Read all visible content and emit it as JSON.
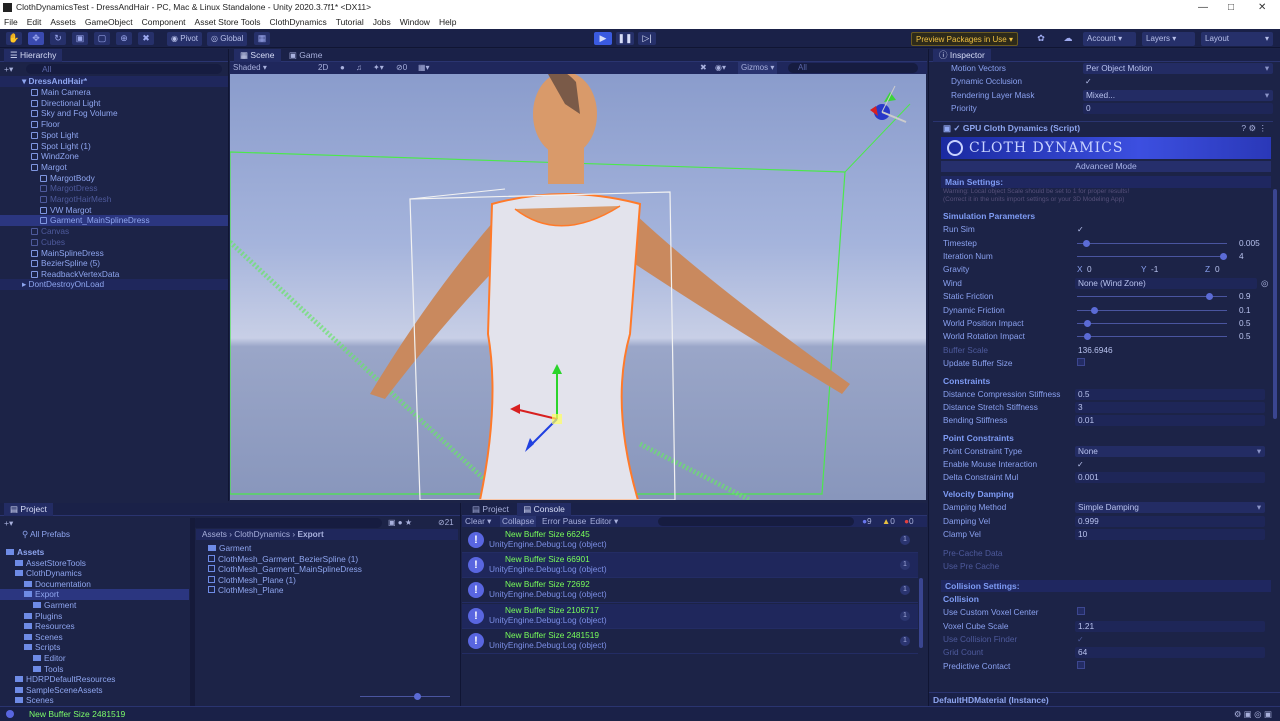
{
  "window": {
    "title": "ClothDynamicsTest - DressAndHair - PC, Mac & Linux Standalone - Unity 2020.3.7f1* <DX11>"
  },
  "menu": [
    "File",
    "Edit",
    "Assets",
    "GameObject",
    "Component",
    "Asset Store Tools",
    "ClothDynamics",
    "Tutorial",
    "Jobs",
    "Window",
    "Help"
  ],
  "toolbar": {
    "pivot": "Pivot",
    "global": "Global",
    "preview_packages": "Preview Packages in Use",
    "account": "Account",
    "layers": "Layers",
    "layout": "Layout"
  },
  "hierarchy": {
    "title": "Hierarchy",
    "search_placeholder": "All",
    "scene_root": "DressAndHair*",
    "items": [
      {
        "label": "Main Camera",
        "indent": 1,
        "dim": false
      },
      {
        "label": "Directional Light",
        "indent": 1,
        "dim": false
      },
      {
        "label": "Sky and Fog Volume",
        "indent": 1,
        "dim": false
      },
      {
        "label": "Floor",
        "indent": 1,
        "dim": false
      },
      {
        "label": "Spot Light",
        "indent": 1,
        "dim": false
      },
      {
        "label": "Spot Light (1)",
        "indent": 1,
        "dim": false
      },
      {
        "label": "WindZone",
        "indent": 1,
        "dim": false
      },
      {
        "label": "Margot",
        "indent": 1,
        "dim": false
      },
      {
        "label": "MargotBody",
        "indent": 2,
        "dim": false
      },
      {
        "label": "MargotDress",
        "indent": 2,
        "dim": true
      },
      {
        "label": "MargotHairMesh",
        "indent": 2,
        "dim": true
      },
      {
        "label": "VW Margot",
        "indent": 2,
        "dim": false
      },
      {
        "label": "Garment_MainSplineDress",
        "indent": 2,
        "dim": false,
        "selected": true
      },
      {
        "label": "Canvas",
        "indent": 1,
        "dim": true
      },
      {
        "label": "Cubes",
        "indent": 1,
        "dim": true
      },
      {
        "label": "MainSplineDress",
        "indent": 1,
        "dim": false
      },
      {
        "label": "BezierSpline (5)",
        "indent": 1,
        "dim": false
      },
      {
        "label": "ReadbackVertexData",
        "indent": 1,
        "dim": false
      }
    ],
    "dont_destroy": "DontDestroyOnLoad"
  },
  "scene_view": {
    "tab_scene": "Scene",
    "tab_game": "Game",
    "shading": "Shaded",
    "mode_2d": "2D",
    "gizmos": "Gizmos",
    "search_placeholder": "All"
  },
  "project": {
    "tab_project": "Project",
    "tab_console": "Console",
    "all_prefabs": "All Prefabs",
    "tree": [
      {
        "label": "Assets",
        "indent": 0,
        "bold": true
      },
      {
        "label": "AssetStoreTools",
        "indent": 1
      },
      {
        "label": "ClothDynamics",
        "indent": 1
      },
      {
        "label": "Documentation",
        "indent": 2
      },
      {
        "label": "Export",
        "indent": 2,
        "selected": true
      },
      {
        "label": "Garment",
        "indent": 3
      },
      {
        "label": "Plugins",
        "indent": 2
      },
      {
        "label": "Resources",
        "indent": 2
      },
      {
        "label": "Scenes",
        "indent": 2
      },
      {
        "label": "Scripts",
        "indent": 2
      },
      {
        "label": "Editor",
        "indent": 3
      },
      {
        "label": "Tools",
        "indent": 3
      },
      {
        "label": "HDRPDefaultResources",
        "indent": 1
      },
      {
        "label": "SampleSceneAssets",
        "indent": 1
      },
      {
        "label": "Scenes",
        "indent": 1
      }
    ],
    "breadcrumb": [
      "Assets",
      "ClothDynamics",
      "Export"
    ],
    "files": [
      "Garment",
      "ClothMesh_Garment_BezierSpline (1)",
      "ClothMesh_Garment_MainSplineDress",
      "ClothMesh_Plane (1)",
      "ClothMesh_Plane"
    ],
    "hidden_count": "21"
  },
  "console": {
    "clear": "Clear",
    "collapse": "Collapse",
    "error_pause": "Error Pause",
    "editor": "Editor",
    "counts": {
      "info": "9",
      "warn": "0",
      "error": "0"
    },
    "entries": [
      {
        "msg": "New Buffer Size 66245",
        "src": "UnityEngine.Debug:Log (object)",
        "count": "1"
      },
      {
        "msg": "New Buffer Size 66901",
        "src": "UnityEngine.Debug:Log (object)",
        "count": "1"
      },
      {
        "msg": "New Buffer Size 72692",
        "src": "UnityEngine.Debug:Log (object)",
        "count": "1"
      },
      {
        "msg": "New Buffer Size 2106717",
        "src": "UnityEngine.Debug:Log (object)",
        "count": "1"
      },
      {
        "msg": "New Buffer Size 2481519",
        "src": "UnityEngine.Debug:Log (object)",
        "count": "1"
      }
    ]
  },
  "inspector": {
    "title": "Inspector",
    "top_rows": [
      {
        "label": "Motion Vectors",
        "value": "Per Object Motion",
        "kind": "dropdown"
      },
      {
        "label": "Dynamic Occlusion",
        "value": "✓",
        "kind": "check"
      },
      {
        "label": "Rendering Layer Mask",
        "value": "Mixed...",
        "kind": "dropdown"
      },
      {
        "label": "Priority",
        "value": "0",
        "kind": "field"
      }
    ],
    "component": "GPU Cloth Dynamics (Script)",
    "banner": "CLOTH DYNAMICS",
    "advanced_mode": "Advanced Mode",
    "main_settings": "Main Settings:",
    "warning_1": "Warning: Local object Scale should be set to 1 for proper results!",
    "warning_2": "(Correct it in the units import settings or your 3D Modeling App)",
    "sim_params": "Simulation Parameters",
    "rows": [
      {
        "label": "Run Sim",
        "kind": "check",
        "value": "✓"
      },
      {
        "label": "Timestep",
        "kind": "slider",
        "value": "0.005",
        "pos": 0.04
      },
      {
        "label": "Iteration Num",
        "kind": "slider",
        "value": "4",
        "pos": 1.0
      },
      {
        "label": "Gravity",
        "kind": "vec",
        "x": "0",
        "y": "-1",
        "z": "0"
      },
      {
        "label": "Wind",
        "kind": "object",
        "value": "None (Wind Zone)"
      },
      {
        "label": "Static Friction",
        "kind": "slider",
        "value": "0.9",
        "pos": 0.9
      },
      {
        "label": "Dynamic Friction",
        "kind": "slider",
        "value": "0.1",
        "pos": 0.1
      },
      {
        "label": "World Position Impact",
        "kind": "slider",
        "value": "0.5",
        "pos": 0.05
      },
      {
        "label": "World Rotation Impact",
        "kind": "slider",
        "value": "0.5",
        "pos": 0.05
      },
      {
        "label": "Buffer Scale",
        "kind": "field",
        "value": "136.6946",
        "dim": true
      },
      {
        "label": "Update Buffer Size",
        "kind": "checkbox"
      }
    ],
    "constraints": "Constraints",
    "constraint_rows": [
      {
        "label": "Distance Compression Stiffness",
        "value": "0.5"
      },
      {
        "label": "Distance Stretch Stiffness",
        "value": "3"
      },
      {
        "label": "Bending Stiffness",
        "value": "0.01"
      }
    ],
    "point_constraints": "Point Constraints",
    "point_rows": [
      {
        "label": "Point Constraint Type",
        "kind": "dropdown",
        "value": "None"
      },
      {
        "label": "Enable Mouse Interaction",
        "kind": "check",
        "value": "✓"
      },
      {
        "label": "Delta Constraint Mul",
        "kind": "field",
        "value": "0.001"
      }
    ],
    "velocity_damping": "Velocity Damping",
    "velocity_rows": [
      {
        "label": "Damping Method",
        "kind": "dropdown",
        "value": "Simple Damping"
      },
      {
        "label": "Damping Vel",
        "kind": "field",
        "value": "0.999"
      },
      {
        "label": "Clamp Vel",
        "kind": "field",
        "value": "10"
      }
    ],
    "precache_rows": [
      {
        "label": "Pre-Cache Data",
        "kind": "dim"
      },
      {
        "label": "Use Pre Cache",
        "kind": "dim"
      }
    ],
    "collision_settings": "Collision Settings:",
    "collision": "Collision",
    "collision_rows": [
      {
        "label": "Use Custom Voxel Center",
        "kind": "checkbox"
      },
      {
        "label": "Voxel Cube Scale",
        "kind": "field",
        "value": "1.21"
      },
      {
        "label": "Use Collision Finder",
        "kind": "check",
        "value": "✓",
        "dim": true
      },
      {
        "label": "Grid Count",
        "kind": "field",
        "value": "64",
        "dim": true
      },
      {
        "label": "Predictive Contact",
        "kind": "checkbox"
      }
    ],
    "material_footer": "DefaultHDMaterial (Instance)"
  },
  "status": {
    "message": "New Buffer Size 2481519"
  }
}
